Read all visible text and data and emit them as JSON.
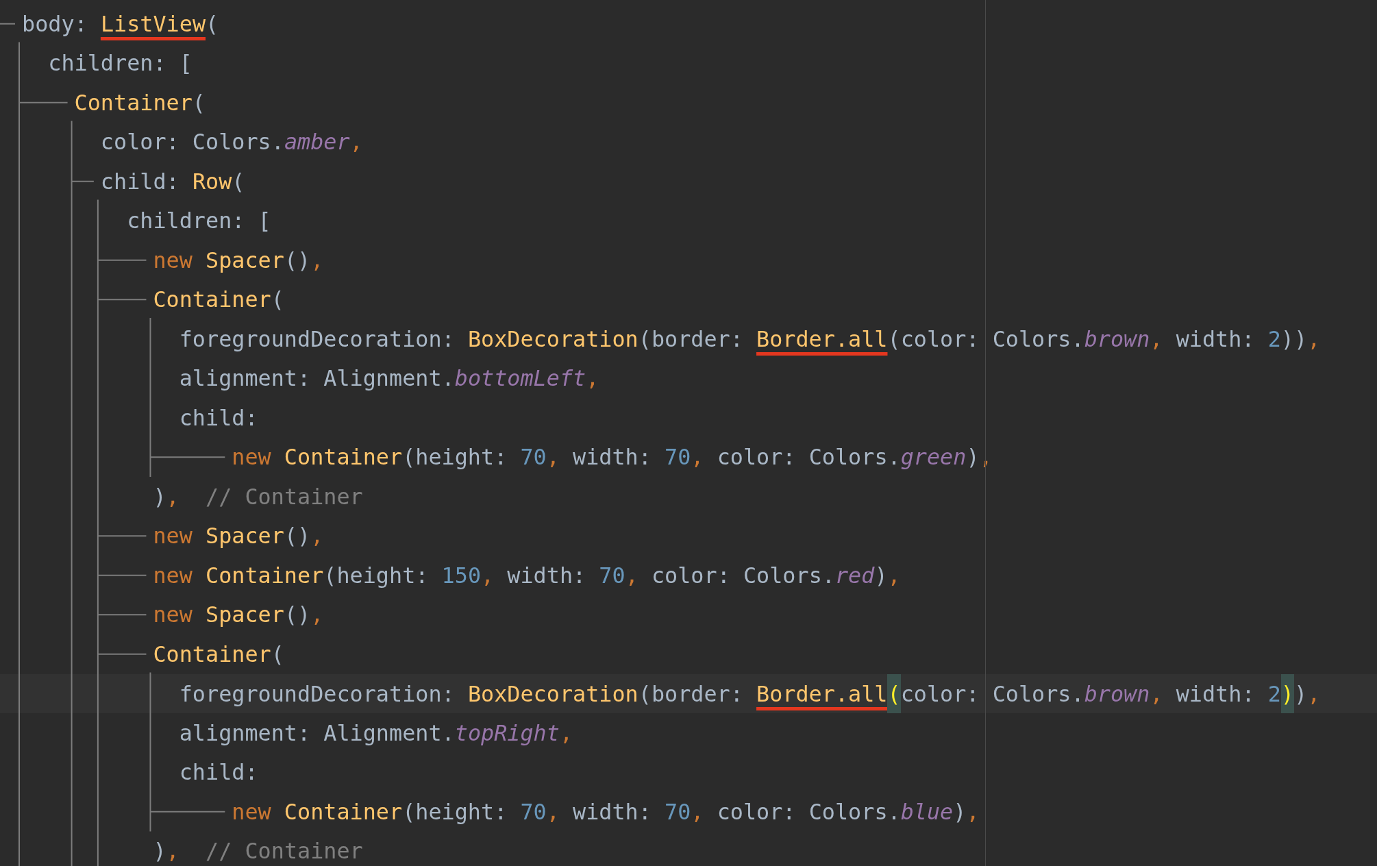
{
  "editor": {
    "lines": [
      {
        "kind": "widget",
        "current": false,
        "tokens": [
          {
            "kind": "plain",
            "text": "body: "
          },
          {
            "kind": "flagged",
            "text": "ListView"
          },
          {
            "kind": "plain",
            "text": "("
          }
        ],
        "children": [
          {
            "kind": "property",
            "current": false,
            "tokens": [
              {
                "kind": "plain",
                "text": "children: ["
              }
            ],
            "children": [
              {
                "kind": "widget",
                "current": false,
                "tokens": [
                  {
                    "kind": "call",
                    "text": "Container"
                  },
                  {
                    "kind": "plain",
                    "text": "("
                  }
                ],
                "children": [
                  {
                    "kind": "property",
                    "current": false,
                    "tokens": [
                      {
                        "kind": "plain",
                        "text": "color: Colors."
                      },
                      {
                        "kind": "constant",
                        "text": "amber"
                      },
                      {
                        "kind": "punct",
                        "text": ","
                      }
                    ]
                  },
                  {
                    "kind": "widget",
                    "current": false,
                    "tokens": [
                      {
                        "kind": "plain",
                        "text": "child: "
                      },
                      {
                        "kind": "call",
                        "text": "Row"
                      },
                      {
                        "kind": "plain",
                        "text": "("
                      }
                    ],
                    "children": [
                      {
                        "kind": "property",
                        "current": false,
                        "tokens": [
                          {
                            "kind": "plain",
                            "text": "children: ["
                          }
                        ],
                        "children": [
                          {
                            "kind": "widget",
                            "current": false,
                            "tokens": [
                              {
                                "kind": "keyword",
                                "text": "new "
                              },
                              {
                                "kind": "call",
                                "text": "Spacer"
                              },
                              {
                                "kind": "plain",
                                "text": "()"
                              },
                              {
                                "kind": "punct",
                                "text": ","
                              }
                            ]
                          },
                          {
                            "kind": "widget",
                            "current": false,
                            "tokens": [
                              {
                                "kind": "call",
                                "text": "Container"
                              },
                              {
                                "kind": "plain",
                                "text": "("
                              }
                            ],
                            "children": [
                              {
                                "kind": "property",
                                "current": false,
                                "tokens": [
                                  {
                                    "kind": "plain",
                                    "text": "foregroundDecoration: "
                                  },
                                  {
                                    "kind": "call",
                                    "text": "BoxDecoration"
                                  },
                                  {
                                    "kind": "plain",
                                    "text": "(border: "
                                  },
                                  {
                                    "kind": "flagged",
                                    "text": "Border.all"
                                  },
                                  {
                                    "kind": "plain",
                                    "text": "(color: Colors."
                                  },
                                  {
                                    "kind": "constant",
                                    "text": "brown"
                                  },
                                  {
                                    "kind": "punct",
                                    "text": ", "
                                  },
                                  {
                                    "kind": "plain",
                                    "text": "width: "
                                  },
                                  {
                                    "kind": "number",
                                    "text": "2"
                                  },
                                  {
                                    "kind": "plain",
                                    "text": "))"
                                  },
                                  {
                                    "kind": "punct",
                                    "text": ","
                                  }
                                ]
                              },
                              {
                                "kind": "property",
                                "current": false,
                                "tokens": [
                                  {
                                    "kind": "plain",
                                    "text": "alignment: Alignment."
                                  },
                                  {
                                    "kind": "constant",
                                    "text": "bottomLeft"
                                  },
                                  {
                                    "kind": "punct",
                                    "text": ","
                                  }
                                ]
                              },
                              {
                                "kind": "property",
                                "current": false,
                                "tokens": [
                                  {
                                    "kind": "plain",
                                    "text": "child:"
                                  }
                                ],
                                "children": [
                                  {
                                    "kind": "continuation",
                                    "current": false,
                                    "tokens": [
                                      {
                                        "kind": "keyword",
                                        "text": "new "
                                      },
                                      {
                                        "kind": "call",
                                        "text": "Container"
                                      },
                                      {
                                        "kind": "plain",
                                        "text": "(height: "
                                      },
                                      {
                                        "kind": "number",
                                        "text": "70"
                                      },
                                      {
                                        "kind": "punct",
                                        "text": ", "
                                      },
                                      {
                                        "kind": "plain",
                                        "text": "width: "
                                      },
                                      {
                                        "kind": "number",
                                        "text": "70"
                                      },
                                      {
                                        "kind": "punct",
                                        "text": ", "
                                      },
                                      {
                                        "kind": "plain",
                                        "text": "color: Colors."
                                      },
                                      {
                                        "kind": "constant",
                                        "text": "green"
                                      },
                                      {
                                        "kind": "plain",
                                        "text": ")"
                                      },
                                      {
                                        "kind": "punct",
                                        "text": ","
                                      }
                                    ]
                                  }
                                ]
                              }
                            ]
                          },
                          {
                            "kind": "property",
                            "current": false,
                            "tokens": [
                              {
                                "kind": "plain",
                                "text": ")"
                              },
                              {
                                "kind": "punct",
                                "text": ",  "
                              },
                              {
                                "kind": "comment",
                                "text": "// Container"
                              }
                            ]
                          },
                          {
                            "kind": "widget",
                            "current": false,
                            "tokens": [
                              {
                                "kind": "keyword",
                                "text": "new "
                              },
                              {
                                "kind": "call",
                                "text": "Spacer"
                              },
                              {
                                "kind": "plain",
                                "text": "()"
                              },
                              {
                                "kind": "punct",
                                "text": ","
                              }
                            ]
                          },
                          {
                            "kind": "widget",
                            "current": false,
                            "tokens": [
                              {
                                "kind": "keyword",
                                "text": "new "
                              },
                              {
                                "kind": "call",
                                "text": "Container"
                              },
                              {
                                "kind": "plain",
                                "text": "(height: "
                              },
                              {
                                "kind": "number",
                                "text": "150"
                              },
                              {
                                "kind": "punct",
                                "text": ", "
                              },
                              {
                                "kind": "plain",
                                "text": "width: "
                              },
                              {
                                "kind": "number",
                                "text": "70"
                              },
                              {
                                "kind": "punct",
                                "text": ", "
                              },
                              {
                                "kind": "plain",
                                "text": "color: Colors."
                              },
                              {
                                "kind": "constant",
                                "text": "red"
                              },
                              {
                                "kind": "plain",
                                "text": ")"
                              },
                              {
                                "kind": "punct",
                                "text": ","
                              }
                            ]
                          },
                          {
                            "kind": "widget",
                            "current": false,
                            "tokens": [
                              {
                                "kind": "keyword",
                                "text": "new "
                              },
                              {
                                "kind": "call",
                                "text": "Spacer"
                              },
                              {
                                "kind": "plain",
                                "text": "()"
                              },
                              {
                                "kind": "punct",
                                "text": ","
                              }
                            ]
                          },
                          {
                            "kind": "widget",
                            "current": false,
                            "tokens": [
                              {
                                "kind": "call",
                                "text": "Container"
                              },
                              {
                                "kind": "plain",
                                "text": "("
                              }
                            ],
                            "children": [
                              {
                                "kind": "property",
                                "current": true,
                                "tokens": [
                                  {
                                    "kind": "plain",
                                    "text": "foregroundDecoration: "
                                  },
                                  {
                                    "kind": "call",
                                    "text": "BoxDecoration"
                                  },
                                  {
                                    "kind": "plain",
                                    "text": "(border: "
                                  },
                                  {
                                    "kind": "flagged",
                                    "text": "Border.all"
                                  },
                                  {
                                    "kind": "brace",
                                    "text": "("
                                  },
                                  {
                                    "kind": "plain",
                                    "text": "color: Colors."
                                  },
                                  {
                                    "kind": "constant",
                                    "text": "brown"
                                  },
                                  {
                                    "kind": "punct",
                                    "text": ", "
                                  },
                                  {
                                    "kind": "plain",
                                    "text": "width: "
                                  },
                                  {
                                    "kind": "number",
                                    "text": "2"
                                  },
                                  {
                                    "kind": "brace",
                                    "text": ")"
                                  },
                                  {
                                    "kind": "plain",
                                    "text": ")"
                                  },
                                  {
                                    "kind": "punct",
                                    "text": ","
                                  }
                                ]
                              },
                              {
                                "kind": "property",
                                "current": false,
                                "tokens": [
                                  {
                                    "kind": "plain",
                                    "text": "alignment: Alignment."
                                  },
                                  {
                                    "kind": "constant",
                                    "text": "topRight"
                                  },
                                  {
                                    "kind": "punct",
                                    "text": ","
                                  }
                                ]
                              },
                              {
                                "kind": "property",
                                "current": false,
                                "tokens": [
                                  {
                                    "kind": "plain",
                                    "text": "child:"
                                  }
                                ],
                                "children": [
                                  {
                                    "kind": "continuation",
                                    "current": false,
                                    "tokens": [
                                      {
                                        "kind": "keyword",
                                        "text": "new "
                                      },
                                      {
                                        "kind": "call",
                                        "text": "Container"
                                      },
                                      {
                                        "kind": "plain",
                                        "text": "(height: "
                                      },
                                      {
                                        "kind": "number",
                                        "text": "70"
                                      },
                                      {
                                        "kind": "punct",
                                        "text": ", "
                                      },
                                      {
                                        "kind": "plain",
                                        "text": "width: "
                                      },
                                      {
                                        "kind": "number",
                                        "text": "70"
                                      },
                                      {
                                        "kind": "punct",
                                        "text": ", "
                                      },
                                      {
                                        "kind": "plain",
                                        "text": "color: Colors."
                                      },
                                      {
                                        "kind": "constant",
                                        "text": "blue"
                                      },
                                      {
                                        "kind": "plain",
                                        "text": ")"
                                      },
                                      {
                                        "kind": "punct",
                                        "text": ","
                                      }
                                    ]
                                  }
                                ]
                              }
                            ]
                          },
                          {
                            "kind": "property",
                            "current": false,
                            "tokens": [
                              {
                                "kind": "plain",
                                "text": ")"
                              },
                              {
                                "kind": "punct",
                                "text": ",  "
                              },
                              {
                                "kind": "comment",
                                "text": "// Container"
                              }
                            ]
                          }
                        ]
                      }
                    ]
                  }
                ]
              }
            ]
          }
        ]
      }
    ]
  }
}
